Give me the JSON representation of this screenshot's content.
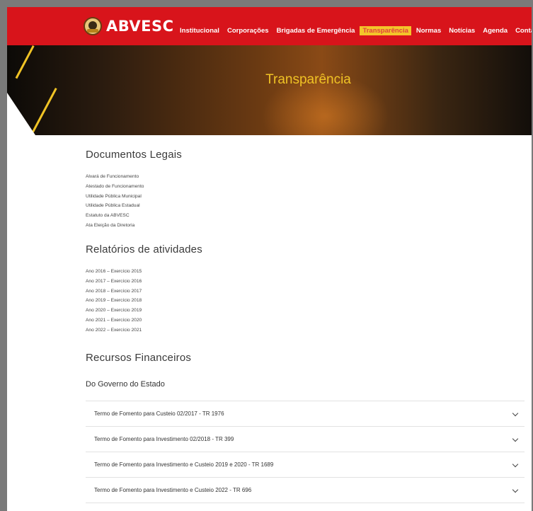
{
  "header": {
    "logo_text": "ABVESC",
    "nav": [
      "Institucional",
      "Corporações",
      "Brigadas de Emergência",
      "Transparência",
      "Normas",
      "Notícias",
      "Agenda",
      "Contato"
    ],
    "active_index": 3
  },
  "hero": {
    "title": "Transparência"
  },
  "documentos": {
    "title": "Documentos Legais",
    "items": [
      "Alvará de Funcionamento",
      "Atestado de Funcionamento",
      "Utilidade Pública Municipal",
      "Utilidade Pública Estadual",
      "Estatuto da ABVESC",
      "Ata Eleição da Diretoria"
    ]
  },
  "relatorios": {
    "title": "Relatórios de atividades",
    "items": [
      "Ano 2016 – Exercício 2015",
      "Ano 2017 – Exercício 2016",
      "Ano 2018 – Exercício 2017",
      "Ano 2019 – Exercício 2018",
      "Ano 2020 – Exercício 2019",
      "Ano 2021 – Exercício 2020",
      "Ano 2022 – Exercício 2021"
    ]
  },
  "recursos": {
    "title": "Recursos Financeiros",
    "subtitle": "Do Governo do Estado",
    "items": [
      "Termo de Fomento para Custeio 02/2017 - TR 1976",
      "Termo de Fomento para Investimento 02/2018 - TR 399",
      "Termo de Fomento para Investimento e Custeio 2019 e 2020 - TR 1689",
      "Termo de Fomento para Investimento e Custeio 2022 - TR 696"
    ]
  },
  "colors": {
    "brand_red": "#d8141b",
    "accent_yellow": "#f0c325"
  }
}
